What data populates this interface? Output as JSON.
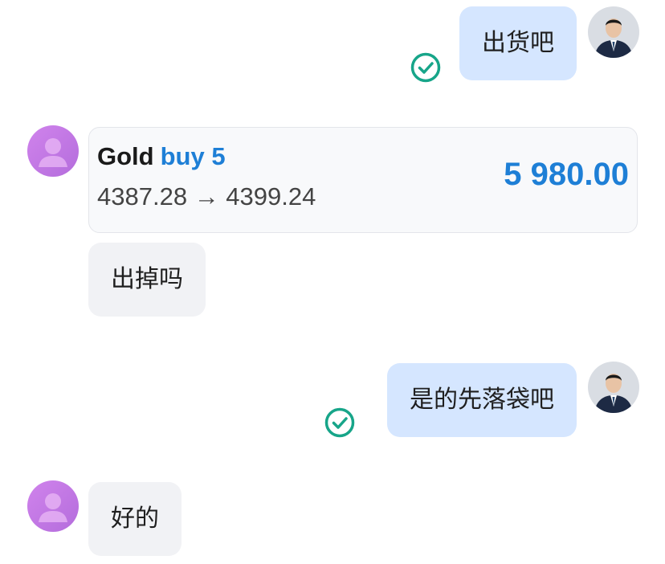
{
  "messages": [
    {
      "id": "m1",
      "direction": "outgoing",
      "text": "出货吧",
      "status_icon": "check-circle-icon"
    },
    {
      "id": "m2",
      "direction": "incoming",
      "type": "trade_card",
      "symbol": "Gold",
      "side": "buy 5",
      "price_range": "4387.28 → 4399.24",
      "amount": "5 980.00"
    },
    {
      "id": "m3",
      "direction": "incoming",
      "text": "出掉吗"
    },
    {
      "id": "m4",
      "direction": "outgoing",
      "text": "是的先落袋吧",
      "status_icon": "check-circle-icon"
    },
    {
      "id": "m5",
      "direction": "incoming",
      "text": "好的"
    }
  ],
  "colors": {
    "outgoing_bubble": "#d5e6ff",
    "incoming_bubble": "#f1f2f5",
    "check_green": "#17a589",
    "accent_blue": "#1e7fd6",
    "incoming_avatar": "#c77be6"
  },
  "icons": {
    "outgoing_avatar": "user-photo-avatar",
    "incoming_avatar": "default-user-avatar",
    "read_status": "check-circle-icon"
  }
}
